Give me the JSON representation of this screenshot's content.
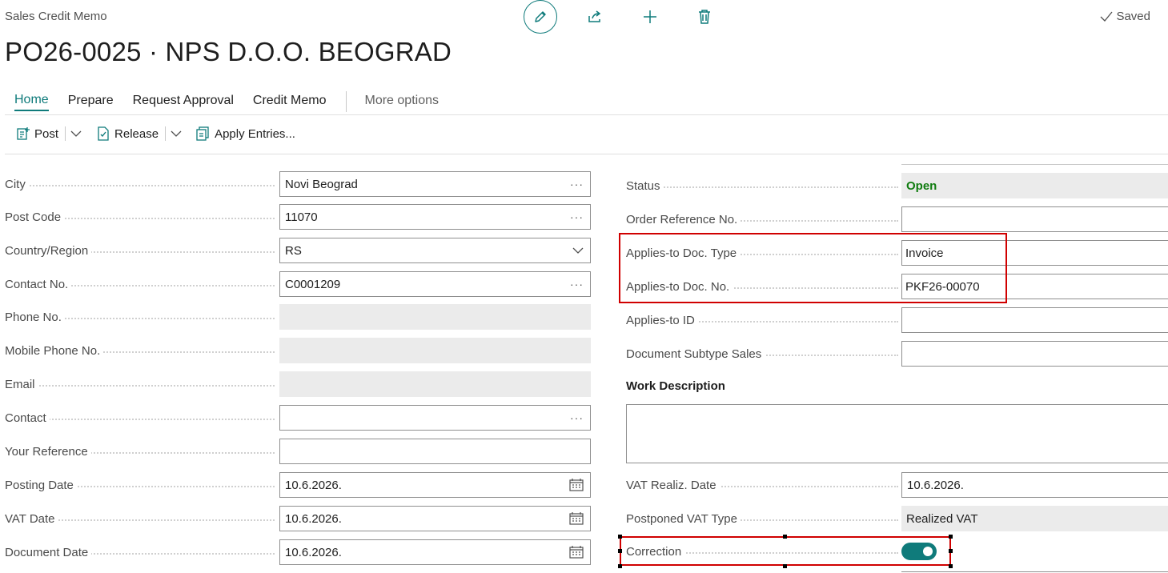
{
  "header": {
    "caption": "Sales Credit Memo",
    "title": "PO26-0025 · NPS D.O.O. BEOGRAD",
    "saved_label": "Saved"
  },
  "toolbar_icons": [
    "pencil-icon",
    "share-icon",
    "plus-icon",
    "trash-icon"
  ],
  "tabs": [
    {
      "label": "Home",
      "active": true
    },
    {
      "label": "Prepare"
    },
    {
      "label": "Request Approval"
    },
    {
      "label": "Credit Memo"
    },
    {
      "label": "More options"
    }
  ],
  "actions": {
    "post": "Post",
    "release": "Release",
    "apply_entries": "Apply Entries..."
  },
  "left_fields": [
    {
      "label": "City",
      "value": "Novi Beograd",
      "trail": "ellipsis"
    },
    {
      "label": "Post Code",
      "value": "11070",
      "trail": "ellipsis"
    },
    {
      "label": "Country/Region",
      "value": "RS",
      "trail": "chevron"
    },
    {
      "label": "Contact No.",
      "value": "C0001209",
      "trail": "ellipsis"
    },
    {
      "label": "Phone No.",
      "value": "",
      "readonly": true
    },
    {
      "label": "Mobile Phone No.",
      "value": "",
      "readonly": true
    },
    {
      "label": "Email",
      "value": "",
      "readonly": true
    },
    {
      "label": "Contact",
      "value": "",
      "trail": "ellipsis"
    },
    {
      "label": "Your Reference",
      "value": ""
    },
    {
      "label": "Posting Date",
      "value": "10.6.2026.",
      "trail": "calendar"
    },
    {
      "label": "VAT Date",
      "value": "10.6.2026.",
      "trail": "calendar"
    },
    {
      "label": "Document Date",
      "value": "10.6.2026.",
      "trail": "calendar"
    }
  ],
  "right_fields": {
    "status": {
      "label": "Status",
      "value": "Open"
    },
    "order_ref": {
      "label": "Order Reference No.",
      "value": ""
    },
    "applies_type": {
      "label": "Applies-to Doc. Type",
      "value": "Invoice"
    },
    "applies_no": {
      "label": "Applies-to Doc. No.",
      "value": "PKF26-00070"
    },
    "applies_id": {
      "label": "Applies-to ID",
      "value": ""
    },
    "doc_subtype": {
      "label": "Document Subtype Sales",
      "value": ""
    },
    "work_description": {
      "label": "Work Description",
      "value": ""
    },
    "vat_realiz": {
      "label": "VAT Realiz. Date",
      "value": "10.6.2026."
    },
    "postponed_vat": {
      "label": "Postponed VAT Type",
      "value": "Realized VAT"
    },
    "correction": {
      "label": "Correction",
      "value": true
    }
  },
  "colors": {
    "accent": "#0f7b7b",
    "status_open": "#107c10",
    "highlight": "#d00000"
  }
}
